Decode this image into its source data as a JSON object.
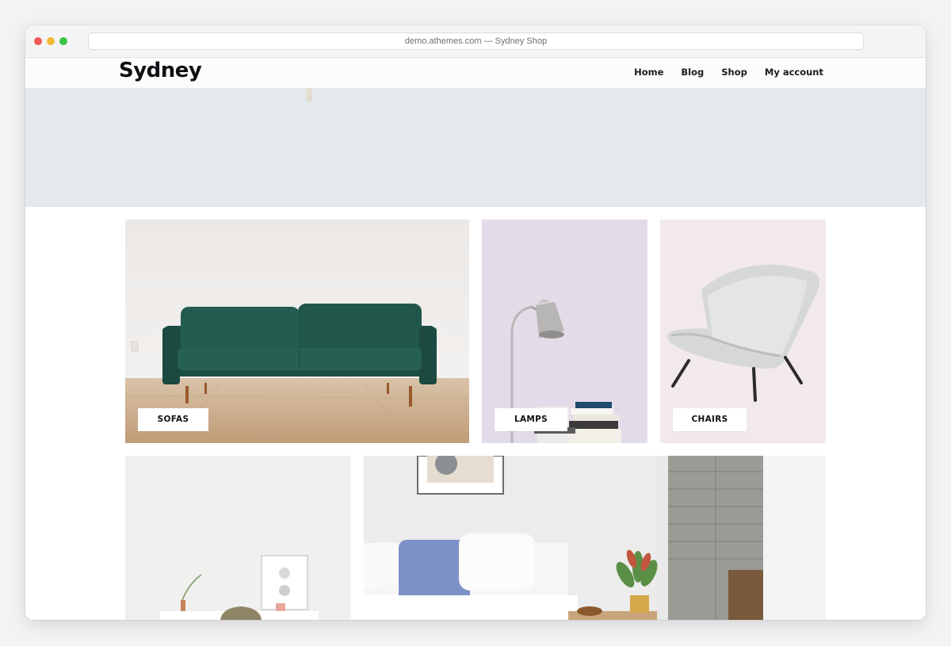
{
  "browser": {
    "url_title": "demo.athemes.com — Sydney Shop"
  },
  "site": {
    "logo": "Sydney",
    "nav": [
      "Home",
      "Blog",
      "Shop",
      "My account"
    ]
  },
  "categories": [
    {
      "label": "SOFAS"
    },
    {
      "label": "LAMPS"
    },
    {
      "label": "CHAIRS"
    }
  ],
  "colors": {
    "hero_bg": "#e3e9ec",
    "sofa_green": "#1f5348",
    "floor_wood": "#c9a783",
    "lamps_bg": "#e4dbe8",
    "chairs_bg": "#f2e9ea"
  }
}
